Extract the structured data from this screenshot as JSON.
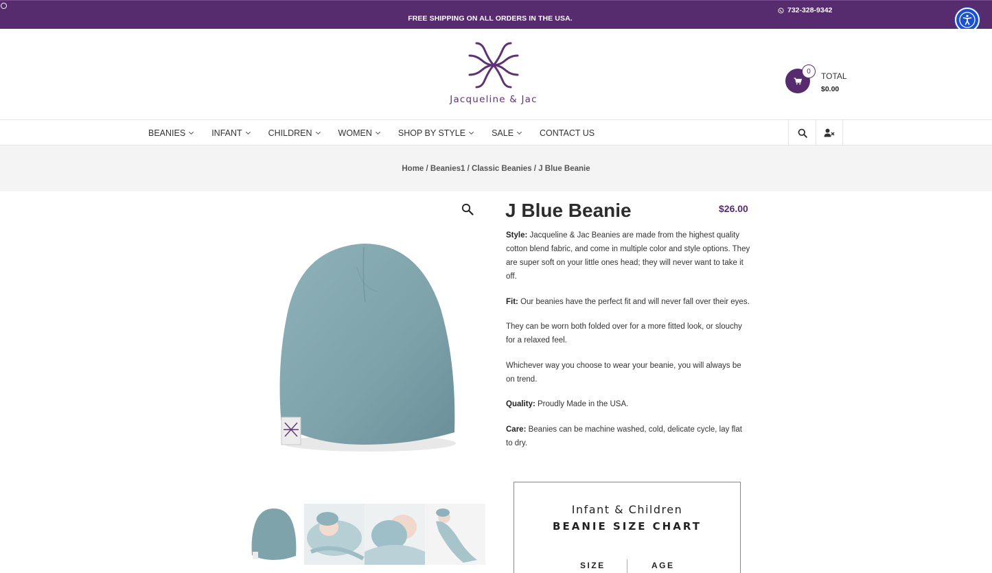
{
  "topbar": {
    "promo": "FREE SHIPPING ON ALL ORDERS IN THE USA.",
    "phone": "732-328-9342"
  },
  "brand": {
    "name": "Jacqueline & Jac",
    "color": "#562c6e"
  },
  "cart": {
    "count": "0",
    "total_label": "TOTAL",
    "total_value": "$0.00"
  },
  "nav": {
    "items": [
      {
        "label": "BEANIES",
        "has_dropdown": true
      },
      {
        "label": "INFANT",
        "has_dropdown": true
      },
      {
        "label": "CHILDREN",
        "has_dropdown": true
      },
      {
        "label": "WOMEN",
        "has_dropdown": true
      },
      {
        "label": "SHOP BY STYLE",
        "has_dropdown": true
      },
      {
        "label": "SALE",
        "has_dropdown": true
      },
      {
        "label": "CONTACT US",
        "has_dropdown": false
      }
    ],
    "icons": [
      "search-icon",
      "user-icon"
    ]
  },
  "breadcrumb": {
    "items": [
      "Home",
      "Beanies1",
      "Classic Beanies",
      "J Blue Beanie"
    ],
    "separator": " / "
  },
  "product": {
    "title": "J Blue Beanie",
    "price": "$26.00",
    "image_color": "#7fa3ab",
    "description": [
      {
        "label": "Style:",
        "text": " Jacqueline & Jac Beanies are made from the highest quality cotton blend fabric, and come in multiple color and style options. They are super soft on your little ones head; they will never want to take it off."
      },
      {
        "label": "Fit:",
        "text": " Our beanies have the perfect fit and will never fall over their eyes."
      },
      {
        "label": "",
        "text": "They can be worn both folded over for a more fitted look, or slouchy for a relaxed feel."
      },
      {
        "label": "",
        "text": "Whichever way you choose to wear your beanie, you will always  be on trend."
      },
      {
        "label": "Quality:",
        "text": " Proudly Made in the USA."
      },
      {
        "label": "Care:",
        "text": " Beanies can be machine washed, cold, delicate cycle, lay flat to dry."
      }
    ]
  },
  "size_chart": {
    "line1": "Infant & Children",
    "line2": "BEANIE SIZE CHART",
    "col1": "SIZE",
    "col2": "AGE"
  }
}
